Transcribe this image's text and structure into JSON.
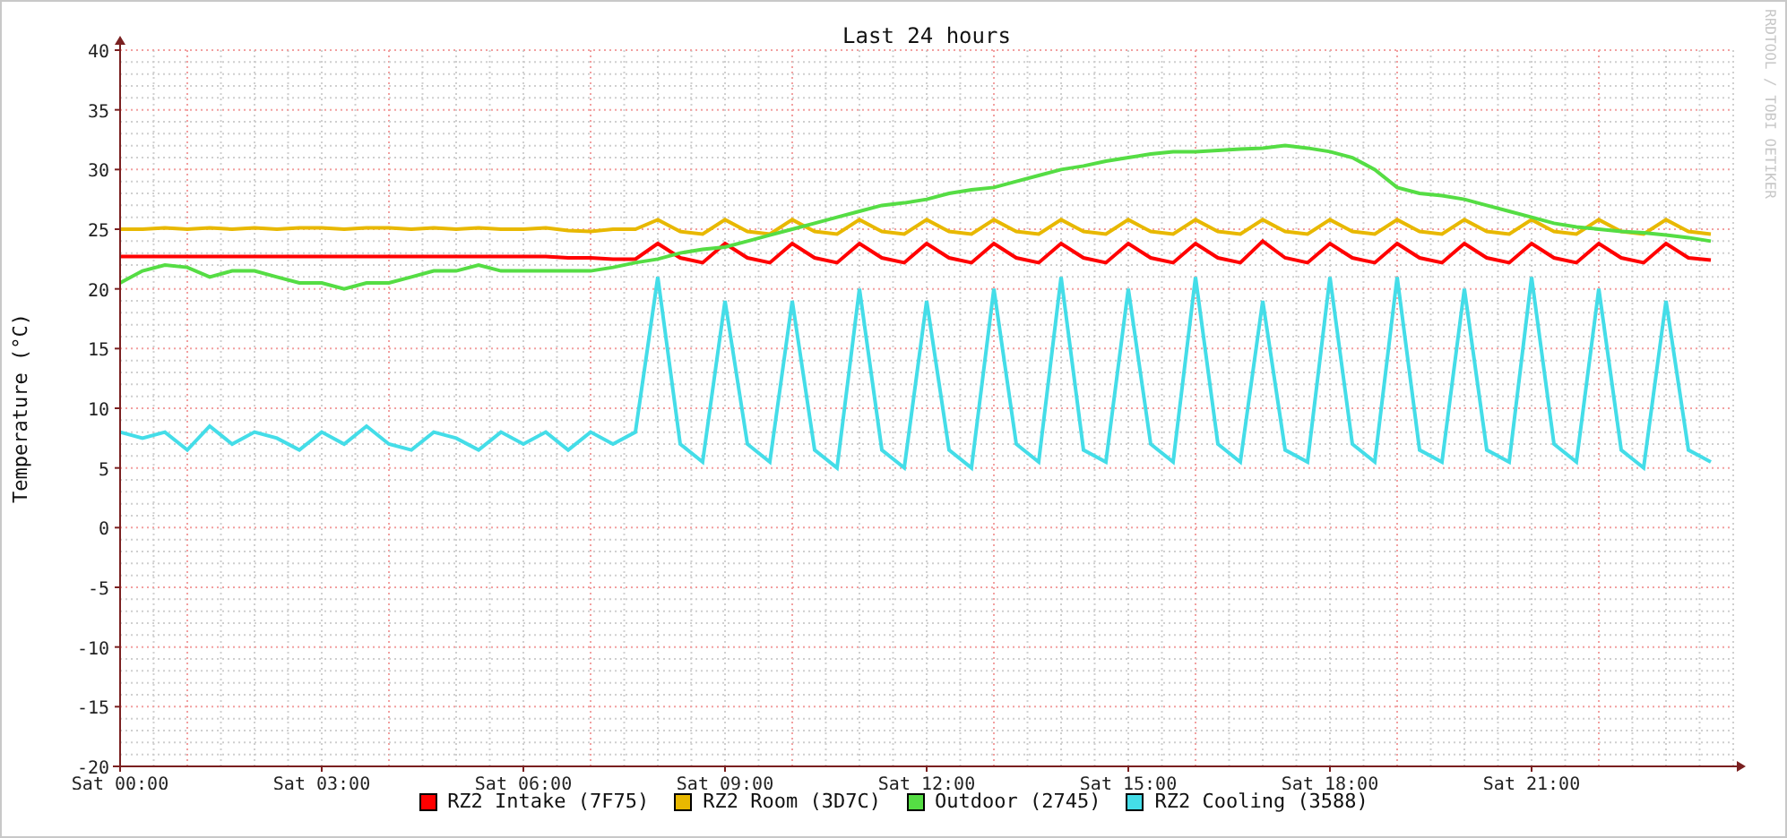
{
  "graph": {
    "side_text": "RRDTOOL / TOBI OETIKER",
    "chart_data": {
      "type": "line",
      "title": "Last 24 hours",
      "ylabel": "Temperature (°C)",
      "categories": [
        "Sat 00:00",
        null,
        null,
        null,
        null,
        null,
        null,
        null,
        null,
        "Sat 03:00",
        null,
        null,
        null,
        null,
        null,
        null,
        null,
        null,
        "Sat 06:00",
        null,
        null,
        null,
        null,
        null,
        null,
        null,
        null,
        "Sat 09:00",
        null,
        null,
        null,
        null,
        null,
        null,
        null,
        null,
        "Sat 12:00",
        null,
        null,
        null,
        null,
        null,
        null,
        null,
        null,
        "Sat 15:00",
        null,
        null,
        null,
        null,
        null,
        null,
        null,
        null,
        "Sat 18:00",
        null,
        null,
        null,
        null,
        null,
        null,
        null,
        null,
        "Sat 21:00",
        null,
        null,
        null,
        null,
        null,
        null,
        null,
        null
      ],
      "ylim": [
        -20,
        40
      ],
      "grid": true,
      "yticks": [
        -20,
        -15,
        -10,
        -5,
        0,
        5,
        10,
        15,
        20,
        25,
        30,
        35,
        40
      ],
      "series": [
        {
          "name": "RZ2 Intake (7F75)",
          "color": "#ff0000",
          "values": [
            22.7,
            22.7,
            22.7,
            22.7,
            22.7,
            22.7,
            22.7,
            22.7,
            22.7,
            22.7,
            22.7,
            22.7,
            22.7,
            22.7,
            22.7,
            22.7,
            22.7,
            22.7,
            22.7,
            22.7,
            22.6,
            22.6,
            22.5,
            22.5,
            23.8,
            22.6,
            22.2,
            23.8,
            22.6,
            22.2,
            23.8,
            22.6,
            22.2,
            23.8,
            22.6,
            22.2,
            23.8,
            22.6,
            22.2,
            23.8,
            22.6,
            22.2,
            23.8,
            22.6,
            22.2,
            23.8,
            22.6,
            22.2,
            23.8,
            22.6,
            22.2,
            24,
            22.6,
            22.2,
            23.8,
            22.6,
            22.2,
            23.8,
            22.6,
            22.2,
            23.8,
            22.6,
            22.2,
            23.8,
            22.6,
            22.2,
            23.8,
            22.6,
            22.2,
            23.8,
            22.6,
            22.4
          ]
        },
        {
          "name": "RZ2 Room (3D7C)",
          "color": "#e8b800",
          "values": [
            25,
            25,
            25.1,
            25,
            25.1,
            25,
            25.1,
            25,
            25.1,
            25.1,
            25,
            25.1,
            25.1,
            25,
            25.1,
            25,
            25.1,
            25,
            25,
            25.1,
            24.9,
            24.8,
            25,
            25,
            25.8,
            24.8,
            24.6,
            25.8,
            24.8,
            24.6,
            25.8,
            24.8,
            24.6,
            25.8,
            24.8,
            24.6,
            25.8,
            24.8,
            24.6,
            25.8,
            24.8,
            24.6,
            25.8,
            24.8,
            24.6,
            25.8,
            24.8,
            24.6,
            25.8,
            24.8,
            24.6,
            25.8,
            24.8,
            24.6,
            25.8,
            24.8,
            24.6,
            25.8,
            24.8,
            24.6,
            25.8,
            24.8,
            24.6,
            25.8,
            24.8,
            24.6,
            25.8,
            24.8,
            24.6,
            25.8,
            24.8,
            24.6
          ]
        },
        {
          "name": "Outdoor (2745)",
          "color": "#55dd44",
          "values": [
            20.5,
            21.5,
            22,
            21.8,
            21,
            21.5,
            21.5,
            21,
            20.5,
            20.5,
            20,
            20.5,
            20.5,
            21,
            21.5,
            21.5,
            22,
            21.5,
            21.5,
            21.5,
            21.5,
            21.5,
            21.8,
            22.2,
            22.5,
            23,
            23.3,
            23.5,
            24,
            24.5,
            25,
            25.5,
            26,
            26.5,
            27,
            27.2,
            27.5,
            28,
            28.3,
            28.5,
            29,
            29.5,
            30,
            30.3,
            30.7,
            31,
            31.3,
            31.5,
            31.5,
            31.6,
            31.7,
            31.8,
            32,
            31.8,
            31.5,
            31,
            30,
            28.5,
            28,
            27.8,
            27.5,
            27,
            26.5,
            26,
            25.5,
            25.2,
            25,
            24.8,
            24.7,
            24.5,
            24.3,
            24
          ]
        },
        {
          "name": "RZ2 Cooling (3588)",
          "color": "#44dde8",
          "values": [
            8,
            7.5,
            8,
            6.5,
            8.5,
            7,
            8,
            7.5,
            6.5,
            8,
            7,
            8.5,
            7,
            6.5,
            8,
            7.5,
            6.5,
            8,
            7,
            8,
            6.5,
            8,
            7,
            8,
            21,
            7,
            5.5,
            19,
            7,
            5.5,
            19,
            6.5,
            5,
            20,
            6.5,
            5,
            19,
            6.5,
            5,
            20,
            7,
            5.5,
            21,
            6.5,
            5.5,
            20,
            7,
            5.5,
            21,
            7,
            5.5,
            19,
            6.5,
            5.5,
            21,
            7,
            5.5,
            21,
            6.5,
            5.5,
            20,
            6.5,
            5.5,
            21,
            7,
            5.5,
            20,
            6.5,
            5,
            19,
            6.5,
            5.5
          ]
        }
      ]
    }
  }
}
